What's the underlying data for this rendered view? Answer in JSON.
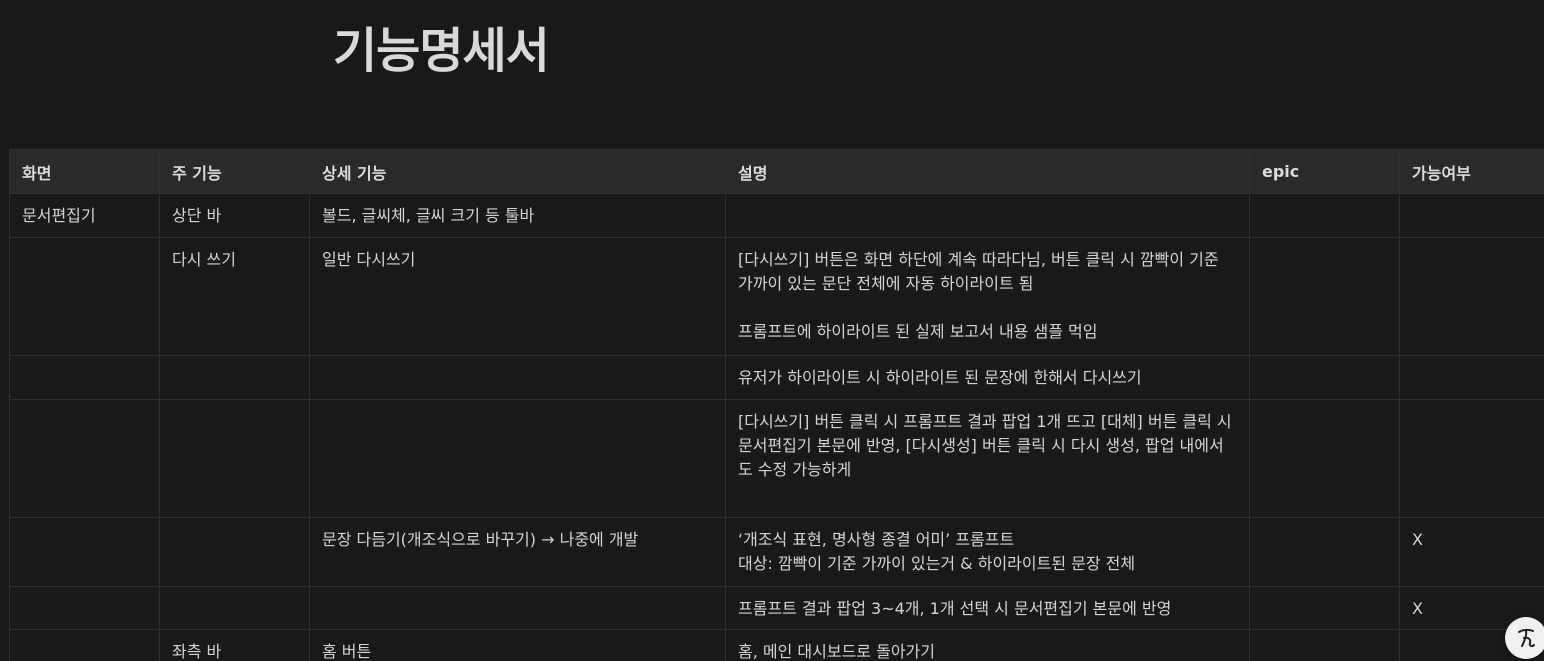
{
  "page": {
    "title": "기능명세서"
  },
  "table": {
    "headers": [
      "화면",
      "주 기능",
      "상세 기능",
      "설명",
      "epic",
      "가능여부"
    ],
    "rows": [
      {
        "screen": "문서편집기",
        "main": "상단 바",
        "detail": "볼드, 글씨체, 글씨 크기 등 툴바",
        "desc": [
          "",
          "",
          ""
        ],
        "epic": "",
        "avail": ""
      },
      {
        "screen": "",
        "main": "다시 쓰기",
        "detail": "일반 다시쓰기",
        "desc": [
          "[다시쓰기] 버튼은 화면 하단에 계속 따라다님, 버튼 클릭 시 깜빡이 기준 가까이 있는 문단 전체에 자동 하이라이트 됨",
          "",
          "프롬프트에 하이라이트 된 실제 보고서 내용 샘플 먹임"
        ],
        "epic": "",
        "avail": ""
      },
      {
        "screen": "",
        "main": "",
        "detail": "",
        "desc": [
          "유저가 하이라이트 시 하이라이트 된 문장에 한해서 다시쓰기",
          "",
          ""
        ],
        "epic": "",
        "avail": ""
      },
      {
        "screen": "",
        "main": "",
        "detail": "",
        "desc": [
          "[다시쓰기] 버튼 클릭 시 프롬프트 결과 팝업 1개 뜨고 [대체] 버튼 클릭 시 문서편집기 본문에 반영, [다시생성] 버튼 클릭 시 다시 생성, 팝업 내에서도 수정 가능하게",
          "",
          ""
        ],
        "epic": "",
        "avail": ""
      },
      {
        "screen": "",
        "main": "",
        "detail": "문장 다듬기(개조식으로 바꾸기) → 나중에 개발",
        "desc": [
          "‘개조식 표현, 명사형 종결 어미’ 프롬프트",
          "대상: 깜빡이 기준 가까이 있는거 & 하이라이트된 문장 전체",
          ""
        ],
        "epic": "",
        "avail": "X"
      },
      {
        "screen": "",
        "main": "",
        "detail": "",
        "desc": [
          "프롬프트 결과 팝업 3~4개, 1개 선택 시 문서편집기 본문에 반영",
          "",
          ""
        ],
        "epic": "",
        "avail": "X"
      },
      {
        "screen": "",
        "main": "좌측 바",
        "detail": "홈 버튼",
        "desc": [
          "홈, 메인 대시보드로 돌아가기",
          "",
          ""
        ],
        "epic": "",
        "avail": ""
      }
    ]
  },
  "help": {
    "icon": "help-icon"
  }
}
